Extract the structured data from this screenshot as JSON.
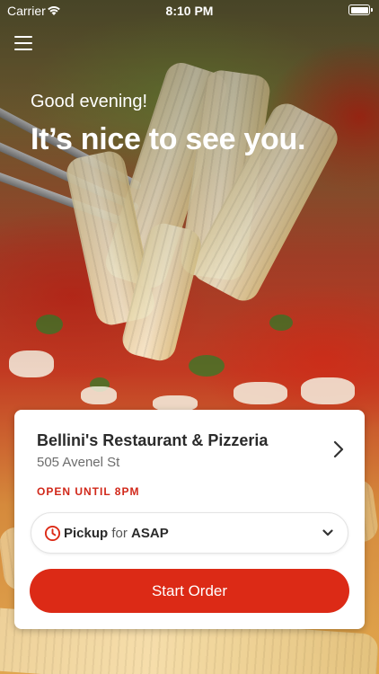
{
  "status_bar": {
    "carrier": "Carrier",
    "time": "8:10 PM"
  },
  "header": {
    "menu_icon": "hamburger-menu-icon",
    "greeting": "Good evening!",
    "headline": "It’s nice to see you."
  },
  "restaurant": {
    "name": "Bellini's Restaurant & Pizzeria",
    "address": "505 Avenel St",
    "hours_status": "OPEN UNTIL 8PM"
  },
  "order_mode": {
    "mode": "Pickup",
    "connector": "for",
    "time": "ASAP",
    "icon": "clock-icon"
  },
  "actions": {
    "start_order_label": "Start Order"
  },
  "colors": {
    "accent": "#dc2a16",
    "text_primary": "#2b2b2b",
    "text_secondary": "#6d6d6d"
  }
}
